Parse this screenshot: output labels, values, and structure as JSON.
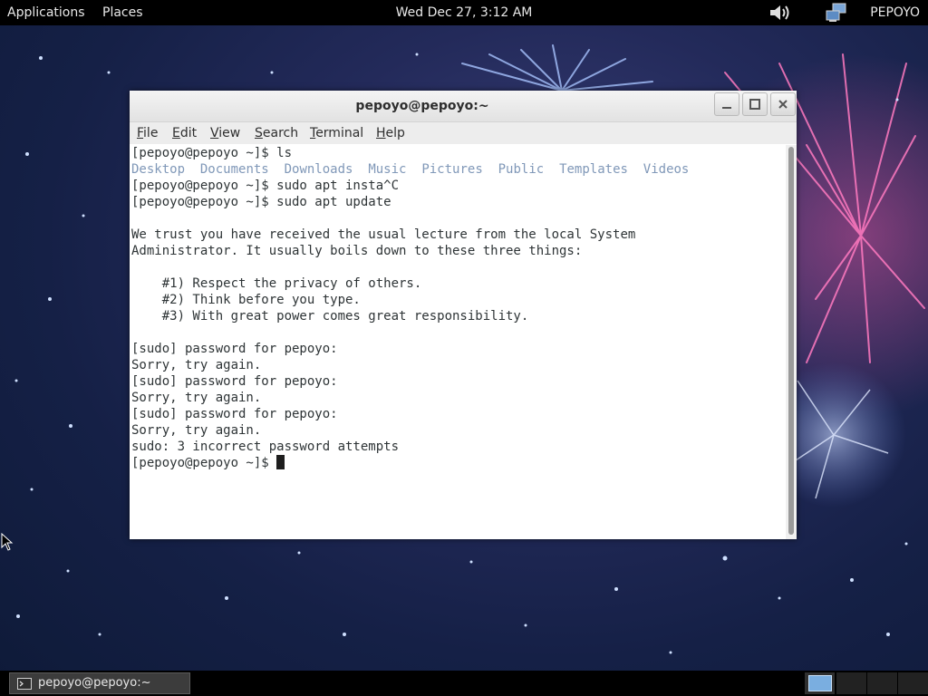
{
  "top_panel": {
    "applications": "Applications",
    "places": "Places",
    "clock": "Wed Dec 27,  3:12 AM",
    "user": "PEPOYO",
    "volume_icon": "speaker-icon",
    "network_icon": "network-icon"
  },
  "window": {
    "title": "pepoyo@pepoyo:~",
    "menu": [
      {
        "label": "File",
        "u": "F",
        "rest": "ile"
      },
      {
        "label": "Edit",
        "u": "E",
        "rest": "dit"
      },
      {
        "label": "View",
        "u": "V",
        "rest": "iew"
      },
      {
        "label": "Search",
        "u": "S",
        "rest": "earch"
      },
      {
        "label": "Terminal",
        "u": "T",
        "rest": "erminal"
      },
      {
        "label": "Help",
        "u": "H",
        "rest": "elp"
      }
    ]
  },
  "terminal": {
    "lines": [
      "[pepoyo@pepoyo ~]$ ls",
      "__DIRS__",
      "[pepoyo@pepoyo ~]$ sudo apt insta^C",
      "[pepoyo@pepoyo ~]$ sudo apt update",
      "",
      "We trust you have received the usual lecture from the local System",
      "Administrator. It usually boils down to these three things:",
      "",
      "    #1) Respect the privacy of others.",
      "    #2) Think before you type.",
      "    #3) With great power comes great responsibility.",
      "",
      "[sudo] password for pepoyo:",
      "Sorry, try again.",
      "[sudo] password for pepoyo:",
      "Sorry, try again.",
      "[sudo] password for pepoyo:",
      "Sorry, try again.",
      "sudo: 3 incorrect password attempts"
    ],
    "directories": [
      "Desktop",
      "Documents",
      "Downloads",
      "Music",
      "Pictures",
      "Public",
      "Templates",
      "Videos"
    ],
    "prompt": "[pepoyo@pepoyo ~]$ "
  },
  "taskbar": {
    "task_label": "pepoyo@pepoyo:~"
  },
  "colors": {
    "directory": "#8098b8",
    "panel": "#000000",
    "workspace_active": "#7aaee0"
  }
}
